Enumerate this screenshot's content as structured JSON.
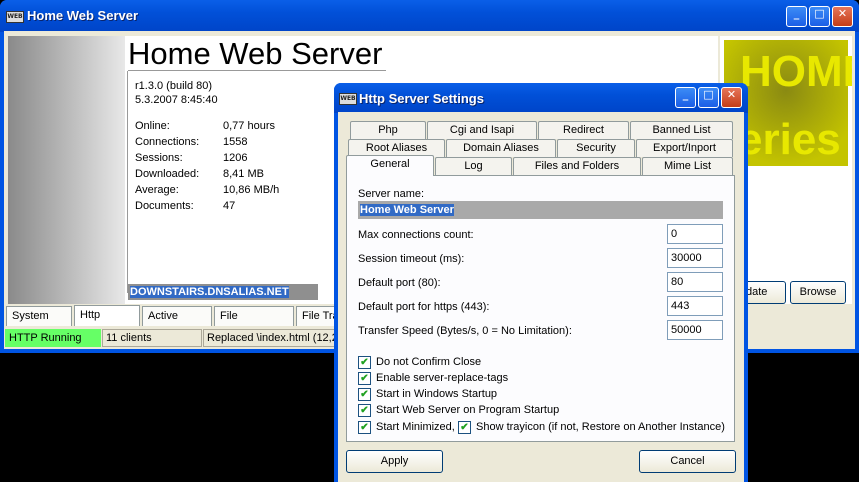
{
  "main_window": {
    "title": "Home Web Server",
    "app_title": "Home Web Server",
    "version": "r1.3.0 (build 80)",
    "datetime": "5.3.2007 8:45:40",
    "stats": [
      {
        "label": "Online:",
        "value": "0,77 hours"
      },
      {
        "label": "Connections:",
        "value": "1558"
      },
      {
        "label": "Sessions:",
        "value": "1206"
      },
      {
        "label": "Downloaded:",
        "value": "8,41 MB"
      },
      {
        "label": "Average:",
        "value": "10,86 MB/h"
      },
      {
        "label": "Documents:",
        "value": "47"
      }
    ],
    "hostname": "DOWNSTAIRS.DNSALIAS.NET",
    "logo_text": [
      "HOME",
      "eries"
    ],
    "update_button": "date",
    "browse_button": "Browse",
    "tabs": [
      "System Log",
      "Http Server",
      "Active Users",
      "File Monitoring",
      "File Tra"
    ],
    "status": {
      "state": "HTTP Running",
      "clients": "11 clients",
      "message": "Replaced \\index.html (12,2"
    },
    "status_color": "#66ff66"
  },
  "dialog": {
    "title": "Http Server Settings",
    "tabs_row1": [
      "Php",
      "Cgi and Isapi",
      "Redirect",
      "Banned List"
    ],
    "tabs_row2": [
      "Root Aliases",
      "Domain Aliases",
      "Security",
      "Export/Inport"
    ],
    "tabs_row3": [
      "General",
      "Log",
      "Files and Folders",
      "Mime List"
    ],
    "server_name_label": "Server name:",
    "server_name_value": "Home Web Server",
    "fields": [
      {
        "label": "Max connections count:",
        "value": "0"
      },
      {
        "label": "Session timeout (ms):",
        "value": "30000"
      },
      {
        "label": "Default port (80):",
        "value": "80"
      },
      {
        "label": "Default port for https (443):",
        "value": "443"
      },
      {
        "label": "Transfer Speed (Bytes/s, 0 = No Limitation):",
        "value": "50000"
      }
    ],
    "checkboxes": [
      {
        "label": "Do not Confirm Close",
        "checked": true
      },
      {
        "label": "Enable server-replace-tags",
        "checked": true
      },
      {
        "label": "Start in Windows Startup",
        "checked": true
      },
      {
        "label": "Start Web Server on Program Startup",
        "checked": true
      },
      {
        "label": "Start Minimized,",
        "checked": true
      }
    ],
    "trayicon_label": "Show trayicon (if not, Restore on Another Instance)",
    "apply_button": "Apply",
    "cancel_button": "Cancel"
  },
  "icons": {
    "app_icon": "web-app-icon",
    "minimize": "minimize-icon",
    "maximize": "maximize-icon",
    "close": "close-icon"
  },
  "colors": {
    "titlebar": "#0054e3",
    "selection": "#316ac5",
    "close_button": "#d4502b"
  }
}
